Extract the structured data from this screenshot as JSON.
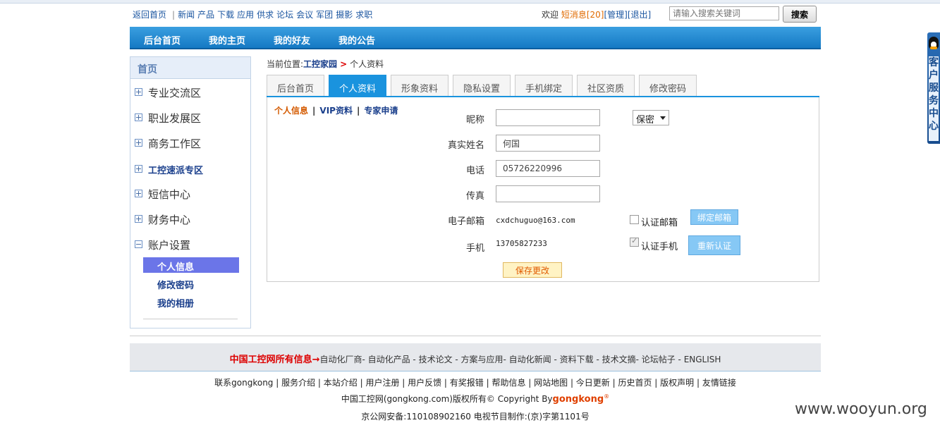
{
  "topbar": {
    "back_home": "返回首页",
    "links": [
      "新闻",
      "产品",
      "下载",
      "应用",
      "供求",
      "论坛",
      "会议",
      "军团",
      "摄影",
      "求职"
    ],
    "welcome": "欢迎",
    "messages": "短消息[20]",
    "manage": "[管理]",
    "logout": "[退出]",
    "search_placeholder": "请输入搜索关键词",
    "search_button": "搜索"
  },
  "mainnav": [
    "后台首页",
    "我的主页",
    "我的好友",
    "我的公告"
  ],
  "sidebar": {
    "home": "首页",
    "items": [
      "专业交流区",
      "职业发展区",
      "商务工作区",
      "工控速派专区",
      "短信中心",
      "财务中心",
      "账户设置"
    ],
    "subitems": [
      "个人信息",
      "修改密码",
      "我的相册"
    ]
  },
  "breadcrumb": {
    "prefix": "当前位置:",
    "home": "工控家园",
    "current": "个人资料"
  },
  "tabs": [
    "后台首页",
    "个人资料",
    "形象资料",
    "隐私设置",
    "手机绑定",
    "社区资质",
    "修改密码"
  ],
  "subnav": [
    "个人信息",
    "VIP资料",
    "专家申请"
  ],
  "form": {
    "nickname_label": "昵称",
    "nickname_value": "",
    "privacy_value": "保密",
    "realname_label": "真实姓名",
    "realname_value": "何国",
    "phone_label": "电话",
    "phone_value": "05726220996",
    "fax_label": "传真",
    "fax_value": "",
    "email_label": "电子邮箱",
    "email_value": "cxdchuguo@163.com",
    "verify_email_label": "认证邮箱",
    "bind_email_button": "绑定邮箱",
    "mobile_label": "手机",
    "mobile_value": "13705827233",
    "verify_mobile_label": "认证手机",
    "reverify_button": "重新认证",
    "save_button": "保存更改"
  },
  "footer": {
    "lead": "中国工控网所有信息→",
    "links": "自动化厂商- 自动化产品 - 技术论文 - 方案与应用- 自动化新闻 - 资料下载 - 技术文摘- 论坛帖子 - ENGLISH",
    "row1": "联系gongkong | 服务介绍 | 本站介绍 | 用户注册 | 用户反馈 | 有奖报错 | 帮助信息 | 网站地图 | 今日更新 | 历史首页 | 版权声明 | 友情链接",
    "copyright": "中国工控网(gongkong.com)版权所有© Copyright By",
    "brand": "gongkong",
    "reg": "®",
    "icp": "京公网安备:110108902160 电视节目制作:(京)字第1101号"
  },
  "watermark": "www.wooyun.org",
  "service_widget": "客户服务中心"
}
